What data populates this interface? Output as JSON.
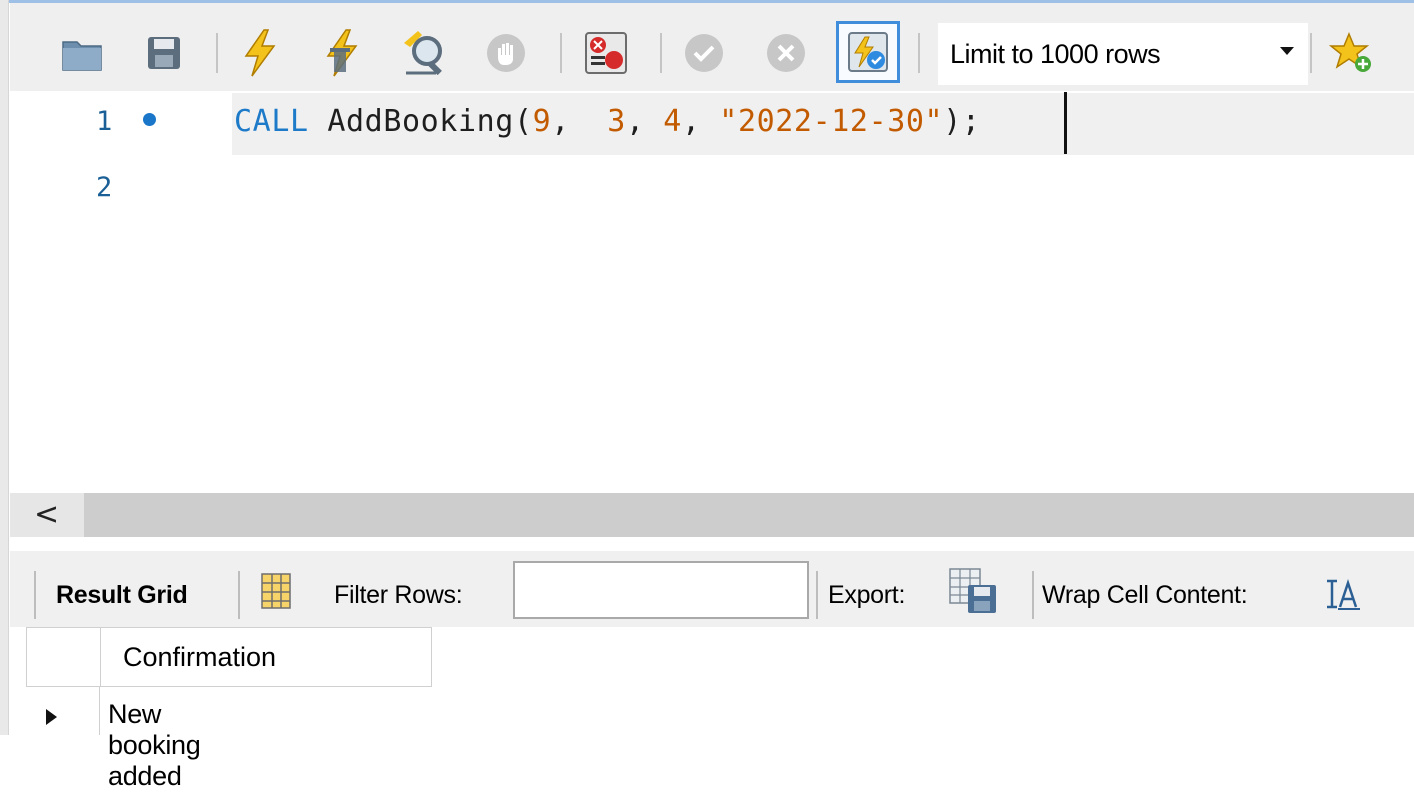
{
  "toolbar": {
    "buttons": [
      {
        "name": "open-file-icon"
      },
      {
        "name": "save-icon"
      },
      {
        "name": "execute-all-icon"
      },
      {
        "name": "execute-current-icon"
      },
      {
        "name": "explain-icon"
      },
      {
        "name": "stop-icon"
      },
      {
        "name": "toggle-error-stop-icon"
      },
      {
        "name": "commit-icon"
      },
      {
        "name": "rollback-icon"
      },
      {
        "name": "autocommit-icon",
        "active": true
      },
      {
        "name": "add-snippet-icon"
      }
    ],
    "limit_select": {
      "value": "Limit to 1000 rows"
    }
  },
  "editor": {
    "lines": [
      {
        "number": "1",
        "has_marker": true
      },
      {
        "number": "2",
        "has_marker": false
      }
    ],
    "code": {
      "keyword": "CALL",
      "function": "AddBooking(",
      "arg1": "9",
      "sep1": ",  ",
      "arg2": "3",
      "sep2": ", ",
      "arg3": "4",
      "sep3": ", ",
      "arg4": "\"2022-12-30\"",
      "end": ");"
    }
  },
  "scrollbar": {
    "left_arrow": "<"
  },
  "result_toolbar": {
    "result_grid_label": "Result Grid",
    "filter_label": "Filter Rows:",
    "filter_value": "",
    "export_label": "Export:",
    "wrap_label": "Wrap Cell Content:"
  },
  "results": {
    "columns": [
      "Confirmation"
    ],
    "rows": [
      [
        "New booking added"
      ]
    ]
  },
  "colors": {
    "keyword": "#1c7ac9",
    "literal": "#c25a00",
    "accent": "#3f8ddb"
  }
}
